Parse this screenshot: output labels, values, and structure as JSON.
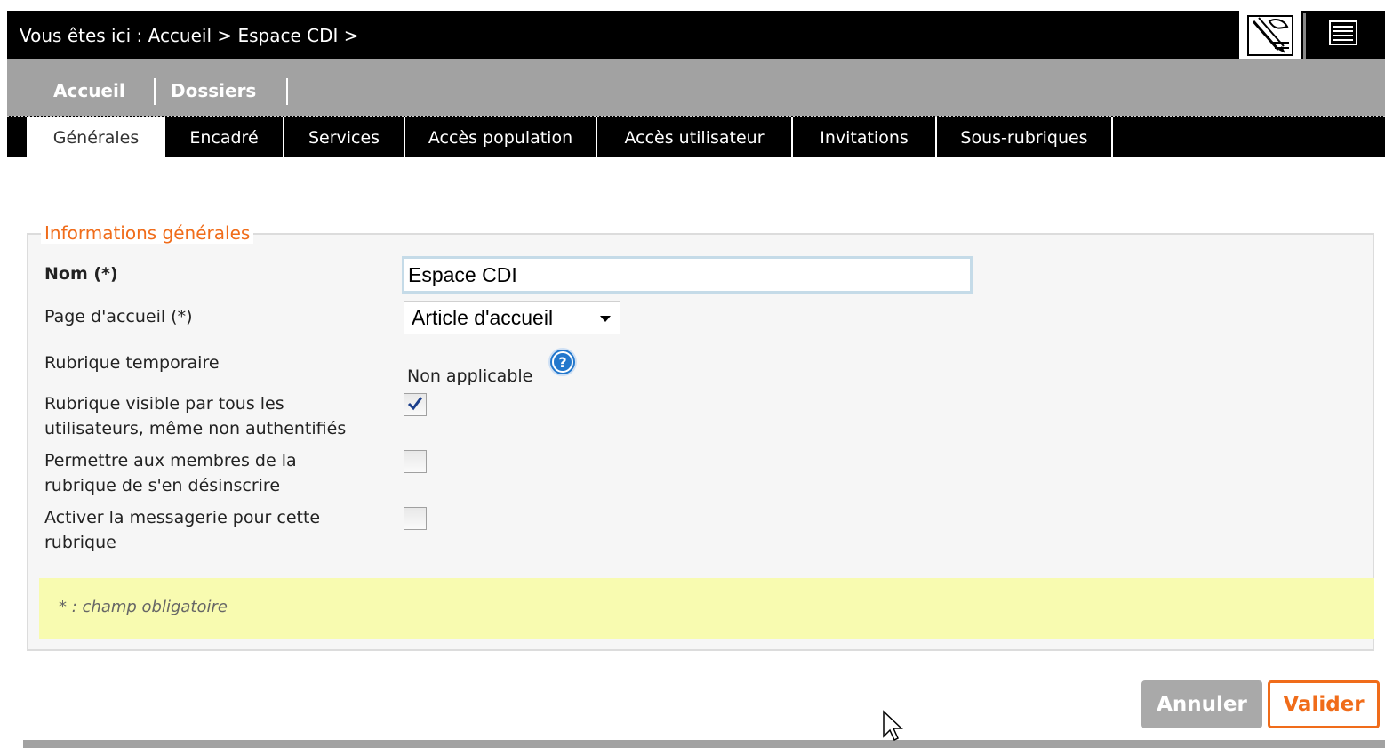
{
  "breadcrumb": {
    "text": "Vous êtes ici : Accueil > Espace CDI >"
  },
  "header_icons": [
    "edit-pencil-icon",
    "list-menu-icon"
  ],
  "nav": {
    "items": [
      {
        "label": "Accueil"
      },
      {
        "label": "Dossiers"
      }
    ]
  },
  "tabs": [
    {
      "label": "Générales",
      "active": true
    },
    {
      "label": "Encadré",
      "active": false
    },
    {
      "label": "Services",
      "active": false
    },
    {
      "label": "Accès population",
      "active": false
    },
    {
      "label": "Accès utilisateur",
      "active": false
    },
    {
      "label": "Invitations",
      "active": false
    },
    {
      "label": "Sous-rubriques",
      "active": false
    }
  ],
  "form": {
    "legend": "Informations générales",
    "fields": {
      "nom": {
        "label": "Nom (*)",
        "value": "Espace CDI"
      },
      "page_accueil": {
        "label": "Page d'accueil (*)",
        "value": "Article d'accueil"
      },
      "rubrique_temporaire": {
        "label": "Rubrique temporaire",
        "value": "Non applicable"
      },
      "visible": {
        "label_line1": "Rubrique visible par tous les",
        "label_line2": "utilisateurs, même non authentifiés",
        "checked": true
      },
      "desinscrire": {
        "label_line1": "Permettre aux membres de la",
        "label_line2": "rubrique de s'en désinscrire",
        "checked": false
      },
      "messagerie": {
        "label_line1": "Activer la messagerie pour cette",
        "label_line2": "rubrique",
        "checked": false
      }
    },
    "note": "* : champ obligatoire"
  },
  "buttons": {
    "cancel": "Annuler",
    "submit": "Valider"
  },
  "colors": {
    "accent": "#f06c1a",
    "header_bg": "#000000",
    "nav_bg": "#a2a2a2",
    "note_bg": "#f8fbb0",
    "help_icon": "#2277cc"
  }
}
